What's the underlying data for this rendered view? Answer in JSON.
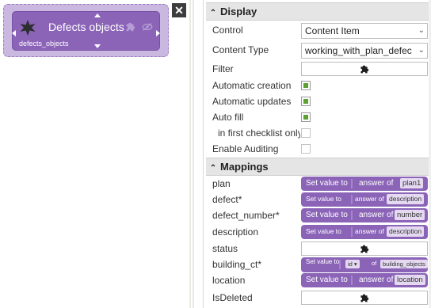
{
  "canvas": {
    "card_title": "Defects objects",
    "card_subtitle": "defects_objects",
    "close_label": "✕"
  },
  "display": {
    "header": "Display",
    "rows": {
      "control_label": "Control",
      "control_value": "Content Item",
      "content_type_label": "Content Type",
      "content_type_value": "working_with_plan_defec",
      "filter_label": "Filter",
      "auto_creation_label": "Automatic creation",
      "auto_updates_label": "Automatic updates",
      "auto_fill_label": "Auto fill",
      "first_checklist_label": "in first checklist only",
      "enable_auditing_label": "Enable Auditing"
    },
    "checks": {
      "auto_creation": true,
      "auto_updates": true,
      "auto_fill": true,
      "first_checklist": false,
      "enable_auditing": false
    }
  },
  "mappings": {
    "header": "Mappings",
    "set_value": "Set value to",
    "answer_of": "answer of",
    "of": "of",
    "id_token": "id",
    "rows": [
      {
        "label": "plan",
        "value": "plan1"
      },
      {
        "label": "defect*",
        "value": "description"
      },
      {
        "label": "defect_number*",
        "value": "number"
      },
      {
        "label": "description",
        "value": "description"
      },
      {
        "label": "status"
      },
      {
        "label": "building_ct*",
        "value": "building_objects"
      },
      {
        "label": "location",
        "value": "location"
      },
      {
        "label": "IsDeleted"
      }
    ]
  },
  "colors": {
    "block": "#8b64b8",
    "checkbox_on": "#5da132"
  }
}
